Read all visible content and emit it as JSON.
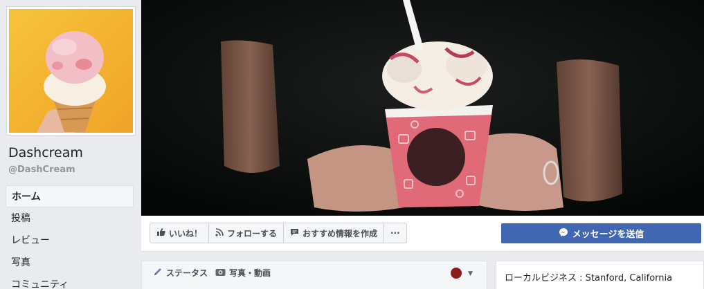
{
  "page": {
    "name": "Dashcream",
    "handle": "@DashCream"
  },
  "nav": {
    "items": [
      {
        "label": "ホーム"
      },
      {
        "label": "投稿"
      },
      {
        "label": "レビュー"
      },
      {
        "label": "写真"
      },
      {
        "label": "コミュニティ"
      }
    ]
  },
  "actions": {
    "like": "いいね！",
    "follow": "フォローする",
    "recommend": "おすすめ情報を作成",
    "more": "···",
    "message": "メッセージを送信"
  },
  "composer": {
    "status": "ステータス",
    "photo_video": "写真・動画"
  },
  "info": {
    "category": "ローカルビジネス : Stanford, California"
  },
  "colors": {
    "accent": "#4267b2",
    "background": "#e9ebee"
  }
}
